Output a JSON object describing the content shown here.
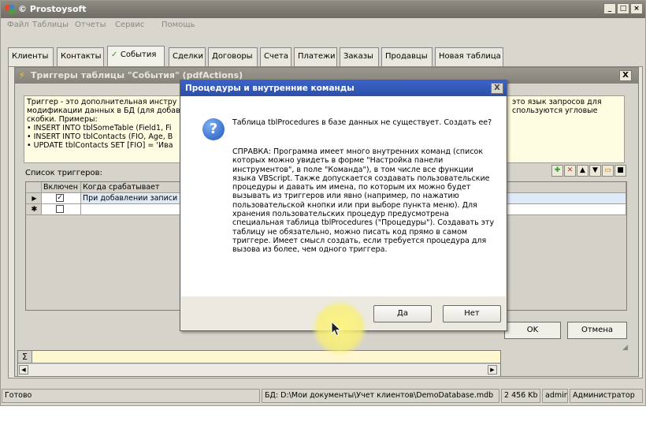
{
  "app": {
    "title": "© Prostoysoft",
    "window_buttons": [
      "_",
      "□",
      "×"
    ]
  },
  "menu": [
    "Файл",
    "Таблицы",
    "Отчеты",
    "Сервис",
    "Помощь"
  ],
  "tabs": [
    {
      "label": "Клиенты",
      "active": false
    },
    {
      "label": "Контакты",
      "active": false
    },
    {
      "label": "События",
      "active": true
    },
    {
      "label": "Сделки",
      "active": false
    },
    {
      "label": "Договоры",
      "active": false
    },
    {
      "label": "Счета",
      "active": false
    },
    {
      "label": "Платежи",
      "active": false
    },
    {
      "label": "Заказы",
      "active": false
    },
    {
      "label": "Продавцы",
      "active": false
    },
    {
      "label": "Новая таблица",
      "active": false
    }
  ],
  "child_window": {
    "title": "Триггеры таблицы \"События\" (pdfActions)",
    "close": "X",
    "info_lines": [
      "Триггер - это дополнительная инстру",
      "модификации данных в БД (для добав",
      "скобки. Примеры:",
      "• INSERT INTO tblSomeTable (Field1, Fi",
      "• INSERT INTO tblContacts (FIO, Age, B",
      "• UPDATE tblContacts SET [FIO] = 'Ива"
    ],
    "info_right_lines": [
      "это язык запросов для",
      "спользуются угловые"
    ],
    "list_label": "Список триггеров:",
    "grid_headers": [
      "Включен",
      "Когда срабатывает"
    ],
    "rows": [
      {
        "marker": "▶",
        "checked": true,
        "when": "При добавлении записи"
      },
      {
        "marker": "✱",
        "checked": false,
        "when": ""
      }
    ],
    "ok": "OK",
    "cancel": "Отмена"
  },
  "dialog": {
    "title": "Процедуры и внутренние команды",
    "close": "X",
    "icon": "?",
    "message": "Таблица tblProcedures в базе данных не существует. Создать ее?",
    "help": "СПРАВКА: Программа имеет много внутренних команд (список которых можно увидеть в форме \"Настройка панели инструментов\", в поле \"Команда\"), в том числе все функции языка VBScript. Также допускается создавать пользовательские процедуры и давать им имена, по которым их можно будет вызывать из триггеров или явно (например, по нажатию пользовательской кнопки или при выборе пункта меню). Для хранения пользовательских процедур предусмотрена специальная таблица tblProcedures (\"Процедуры\"). Создавать эту таблицу не обязательно, можно писать код прямо в самом триггере. Имеет смысл создать, если требуется процедура для вызова из более, чем одного триггера.",
    "yes": "Да",
    "no": "Нет"
  },
  "sum_symbol": "Σ",
  "status": {
    "ready": "Готово",
    "db_label": "БД:",
    "db_path": "D:\\Мои документы\\Учет клиентов\\DemoDatabase.mdb",
    "size": "2 456 Kb",
    "user": "admin",
    "role": "Администратор"
  }
}
